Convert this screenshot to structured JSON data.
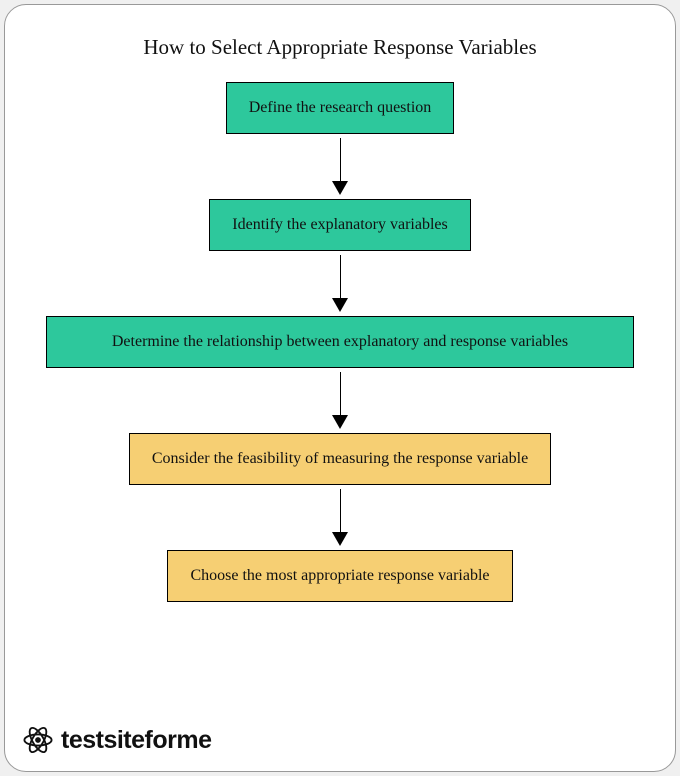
{
  "title": "How to Select Appropriate Response Variables",
  "steps": [
    {
      "label": "Define the research question",
      "color": "green"
    },
    {
      "label": "Identify the explanatory variables",
      "color": "green"
    },
    {
      "label": "Determine the relationship between explanatory and response variables",
      "color": "green"
    },
    {
      "label": "Consider the feasibility of measuring the response variable",
      "color": "yellow"
    },
    {
      "label": "Choose the most appropriate response variable",
      "color": "yellow"
    }
  ],
  "logo_text": "testsiteforme"
}
